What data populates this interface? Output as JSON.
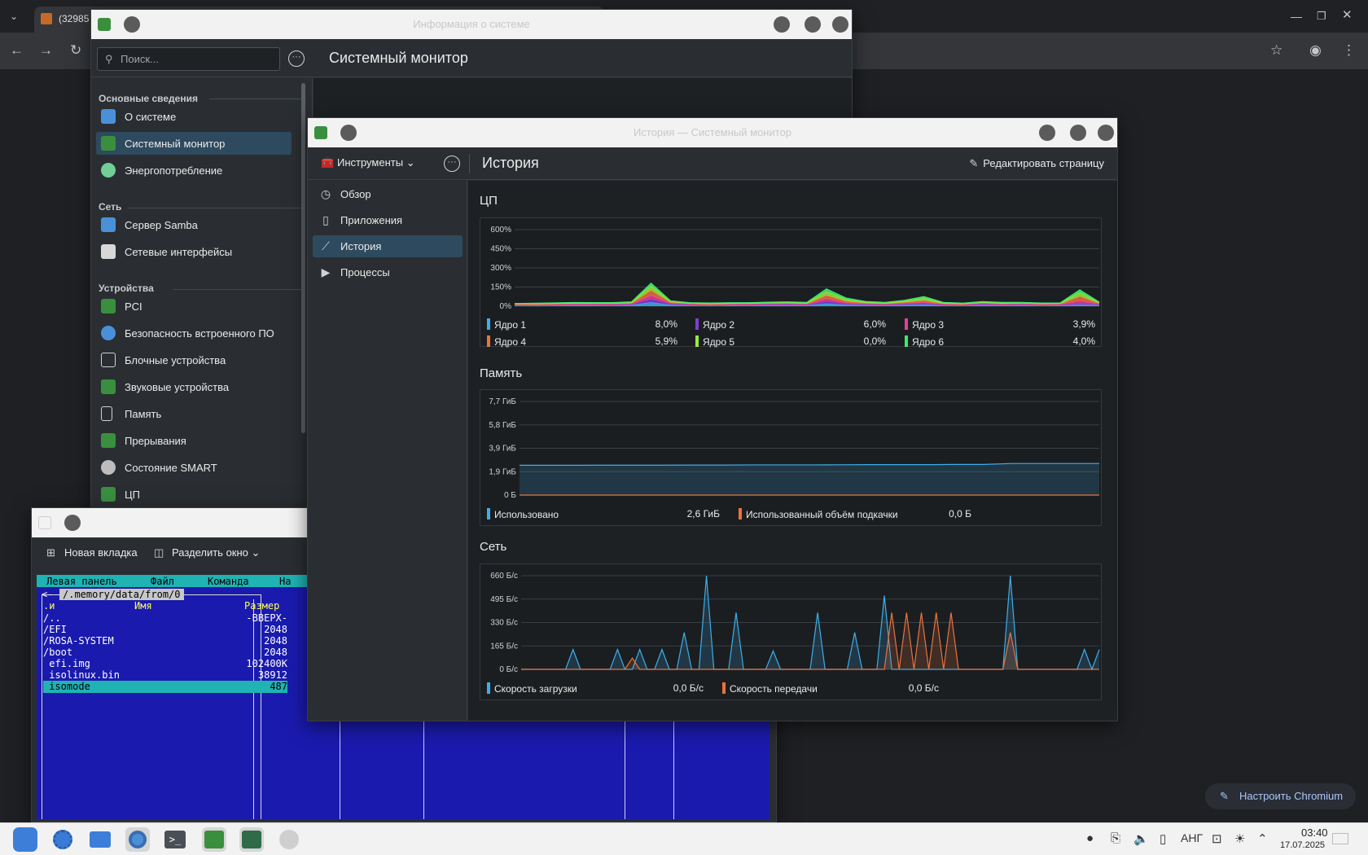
{
  "chromium": {
    "tab_title": "(32985",
    "customize_label": "Настроить Chromium"
  },
  "kinfocenter": {
    "window_title": "Информация о системе",
    "search_placeholder": "Поиск...",
    "page_title": "Системный монитор",
    "sections": [
      {
        "header": "Основные сведения",
        "items": [
          {
            "label": "О системе",
            "icon": "computer-icon"
          },
          {
            "label": "Системный монитор",
            "icon": "system-monitor-icon",
            "active": true
          },
          {
            "label": "Энергопотребление",
            "icon": "battery-icon"
          }
        ]
      },
      {
        "header": "Сеть",
        "items": [
          {
            "label": "Сервер Samba",
            "icon": "samba-icon"
          },
          {
            "label": "Сетевые интерфейсы",
            "icon": "network-card-icon"
          }
        ]
      },
      {
        "header": "Устройства",
        "items": [
          {
            "label": "PCI",
            "icon": "pci-card-icon"
          },
          {
            "label": "Безопасность встроенного ПО",
            "icon": "shield-icon"
          },
          {
            "label": "Блочные устройства",
            "icon": "drive-icon"
          },
          {
            "label": "Звуковые устройства",
            "icon": "sound-card-icon"
          },
          {
            "label": "Память",
            "icon": "document-icon"
          },
          {
            "label": "Прерывания",
            "icon": "interrupts-icon"
          },
          {
            "label": "Состояние SMART",
            "icon": "smart-disk-icon"
          },
          {
            "label": "ЦП",
            "icon": "cpu-icon"
          }
        ]
      }
    ]
  },
  "terminal": {
    "new_tab_label": "Новая вкладка",
    "split_label": "Разделить окно",
    "mc": {
      "menu": [
        "Левая панель",
        "Файл",
        "Команда",
        "На"
      ],
      "path": "/.memory/data/from/0",
      "path_prefix": "<-",
      "header_sort": ".и",
      "header_name": "Имя",
      "header_size": "Размер",
      "rows": [
        {
          "name": "/..",
          "size": "-ВВЕРХ-"
        },
        {
          "name": "/EFI",
          "size": "2048"
        },
        {
          "name": "/ROSA-SYSTEM",
          "size": "2048"
        },
        {
          "name": "/boot",
          "size": "2048"
        },
        {
          "name": " efi.img",
          "size": "102400K"
        },
        {
          "name": " isolinux.bin",
          "size": "38912"
        },
        {
          "name": " isomode",
          "size": "487",
          "selected": true
        }
      ]
    }
  },
  "sysmon": {
    "window_title": "История — Системный монитор",
    "tools_label": "Инструменты",
    "page_title": "История",
    "edit_label": "Редактировать страницу",
    "nav": [
      {
        "label": "Обзор",
        "icon": "overview-icon"
      },
      {
        "label": "Приложения",
        "icon": "applications-icon"
      },
      {
        "label": "История",
        "icon": "history-icon",
        "active": true
      },
      {
        "label": "Процессы",
        "icon": "processes-icon"
      }
    ],
    "cpu": {
      "title": "ЦП",
      "legend": [
        {
          "label": "Ядро 1",
          "value": "8,0%",
          "color": "#3daee9"
        },
        {
          "label": "Ядро 2",
          "value": "6,0%",
          "color": "#7f3dd6"
        },
        {
          "label": "Ядро 3",
          "value": "3,9%",
          "color": "#e93d9a"
        },
        {
          "label": "Ядро 4",
          "value": "5,9%",
          "color": "#e9733d"
        },
        {
          "label": "Ядро 5",
          "value": "0,0%",
          "color": "#9be93d"
        },
        {
          "label": "Ядро 6",
          "value": "4,0%",
          "color": "#3de96d"
        }
      ]
    },
    "memory": {
      "title": "Память",
      "legend": [
        {
          "label": "Использовано",
          "value": "2,6 ГиБ",
          "color": "#3daee9"
        },
        {
          "label": "Использованный объём подкачки",
          "value": "0,0 Б",
          "color": "#e9733d"
        }
      ]
    },
    "network": {
      "title": "Сеть",
      "legend": [
        {
          "label": "Скорость загрузки",
          "value": "0,0 Б/с",
          "color": "#3daee9"
        },
        {
          "label": "Скорость передачи",
          "value": "0,0 Б/с",
          "color": "#e9733d"
        }
      ]
    }
  },
  "chart_data": [
    {
      "type": "area",
      "title": "ЦП",
      "ylabels": [
        "600%",
        "450%",
        "300%",
        "150%",
        "0%"
      ],
      "ylim": [
        0,
        600
      ],
      "series": [
        {
          "name": "Ядро 1",
          "color": "#3daee9",
          "values": [
            5,
            3,
            4,
            8,
            6,
            4,
            9,
            30,
            10,
            5,
            4,
            6,
            5,
            8,
            7,
            6,
            20,
            10,
            8,
            6,
            9,
            12,
            5,
            4,
            8,
            6,
            7,
            5,
            6,
            10,
            8
          ]
        },
        {
          "name": "Ядро 2",
          "color": "#7f3dd6",
          "values": [
            4,
            5,
            6,
            3,
            5,
            7,
            6,
            25,
            8,
            6,
            5,
            4,
            6,
            5,
            7,
            5,
            18,
            8,
            6,
            5,
            8,
            10,
            6,
            5,
            7,
            5,
            6,
            4,
            5,
            8,
            6
          ]
        },
        {
          "name": "Ядро 3",
          "color": "#e93d9a",
          "values": [
            3,
            4,
            3,
            5,
            4,
            5,
            4,
            30,
            6,
            4,
            3,
            5,
            4,
            6,
            5,
            4,
            22,
            9,
            5,
            4,
            7,
            9,
            4,
            3,
            6,
            4,
            5,
            4,
            4,
            25,
            5
          ]
        },
        {
          "name": "Ядро 4",
          "color": "#e9733d",
          "values": [
            4,
            3,
            5,
            4,
            6,
            4,
            5,
            40,
            7,
            5,
            4,
            3,
            5,
            4,
            6,
            5,
            25,
            12,
            6,
            5,
            6,
            14,
            5,
            4,
            6,
            5,
            4,
            5,
            3,
            35,
            4
          ]
        },
        {
          "name": "Ядро 5",
          "color": "#9be93d",
          "values": [
            3,
            5,
            4,
            6,
            3,
            5,
            6,
            35,
            6,
            4,
            5,
            6,
            3,
            5,
            4,
            6,
            30,
            15,
            7,
            6,
            10,
            18,
            6,
            5,
            4,
            6,
            5,
            3,
            5,
            30,
            5
          ]
        },
        {
          "name": "Ядро 6",
          "color": "#3de96d",
          "values": [
            2,
            3,
            4,
            3,
            4,
            3,
            4,
            20,
            5,
            3,
            4,
            3,
            4,
            3,
            5,
            4,
            20,
            10,
            5,
            4,
            6,
            12,
            4,
            3,
            5,
            4,
            3,
            4,
            3,
            20,
            4
          ]
        }
      ]
    },
    {
      "type": "area",
      "title": "Память",
      "ylabels": [
        "7,7 ГиБ",
        "5,8 ГиБ",
        "3,9 ГиБ",
        "1,9 ГиБ",
        "0 Б"
      ],
      "ylim": [
        0,
        7.7
      ],
      "series": [
        {
          "name": "Использовано",
          "color": "#3daee9",
          "values": [
            2.45,
            2.45,
            2.45,
            2.46,
            2.46,
            2.46,
            2.47,
            2.47,
            2.48,
            2.48,
            2.48,
            2.49,
            2.5,
            2.5,
            2.5,
            2.52,
            2.52,
            2.6,
            2.6,
            2.6,
            2.6
          ]
        },
        {
          "name": "Использованный объём подкачки",
          "color": "#e9733d",
          "values": [
            0,
            0,
            0,
            0,
            0,
            0,
            0,
            0,
            0,
            0,
            0,
            0,
            0,
            0,
            0,
            0,
            0,
            0,
            0,
            0,
            0
          ]
        }
      ]
    },
    {
      "type": "area",
      "title": "Сеть",
      "ylabels": [
        "660 Б/с",
        "495 Б/с",
        "330 Б/с",
        "165 Б/с",
        "0 Б/с"
      ],
      "ylim": [
        0,
        660
      ],
      "series": [
        {
          "name": "Скорость загрузки",
          "color": "#3daee9",
          "values": [
            0,
            0,
            0,
            0,
            0,
            0,
            0,
            140,
            0,
            0,
            0,
            0,
            0,
            140,
            0,
            0,
            140,
            0,
            0,
            140,
            0,
            0,
            260,
            0,
            0,
            660,
            0,
            0,
            0,
            400,
            0,
            0,
            0,
            0,
            130,
            0,
            0,
            0,
            0,
            0,
            400,
            0,
            0,
            0,
            0,
            260,
            0,
            0,
            0,
            520,
            0,
            0,
            0,
            0,
            0,
            0,
            0,
            0,
            0,
            0,
            0,
            0,
            0,
            0,
            0,
            0,
            660,
            0,
            0,
            0,
            0,
            0,
            0,
            0,
            0,
            0,
            140,
            0,
            140
          ]
        },
        {
          "name": "Скорость передачи",
          "color": "#e9733d",
          "values": [
            0,
            0,
            0,
            0,
            0,
            0,
            0,
            0,
            0,
            0,
            0,
            0,
            0,
            0,
            0,
            80,
            0,
            0,
            0,
            0,
            0,
            0,
            0,
            0,
            0,
            0,
            0,
            0,
            0,
            0,
            0,
            0,
            0,
            0,
            0,
            0,
            0,
            0,
            0,
            0,
            0,
            0,
            0,
            0,
            0,
            0,
            0,
            0,
            0,
            0,
            400,
            0,
            400,
            0,
            400,
            0,
            400,
            0,
            400,
            0,
            0,
            0,
            0,
            0,
            0,
            0,
            260,
            0,
            0,
            0,
            0,
            0,
            0,
            0,
            0,
            0,
            0,
            0,
            0
          ]
        }
      ]
    }
  ],
  "taskbar": {
    "lang": "АНГ",
    "time": "03:40",
    "date": "17.07.2025"
  }
}
